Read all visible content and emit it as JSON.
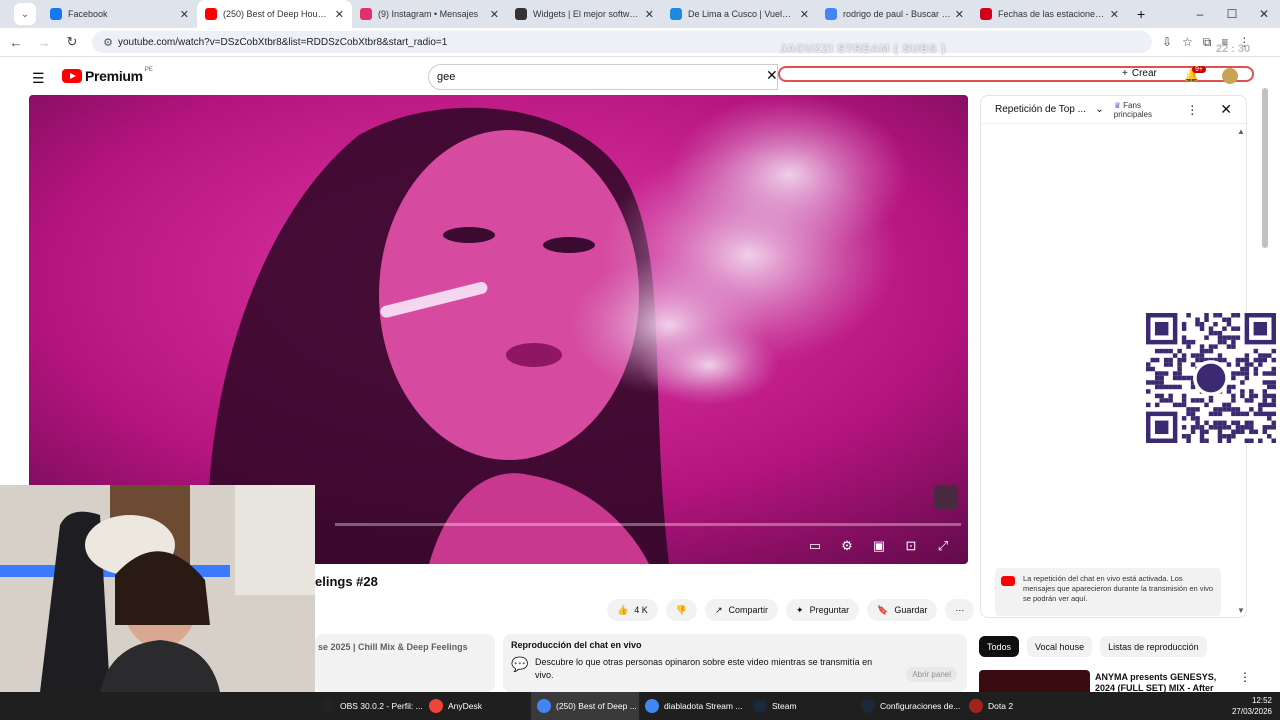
{
  "browser": {
    "tabs": [
      {
        "title": "Facebook",
        "color": "#1877f2",
        "active": false
      },
      {
        "title": "(250) Best of Deep House [20...",
        "color": "#ff0000",
        "active": true
      },
      {
        "title": "(9) Instagram • Mensajes",
        "color": "#e1306c",
        "active": false
      },
      {
        "title": "Widgets | El mejor software p...",
        "color": "#333333",
        "active": false
      },
      {
        "title": "De Lima a Cusco | Vuelos de ...",
        "color": "#1a8be0",
        "active": false
      },
      {
        "title": "rodrigo de paul - Buscar con ...",
        "color": "#4285f4",
        "active": false
      },
      {
        "title": "Fechas de las estaciones astro...",
        "color": "#d0021b",
        "active": false
      }
    ],
    "url": "youtube.com/watch?v=DSzCobXtbr8&list=RDDSzCobXtbr8&start_radio=1"
  },
  "overlay": {
    "stream_title": "JACUZZI STREAM ( SUBS )",
    "clock": "22 : 30"
  },
  "youtube": {
    "logo_text": "Premium",
    "country": "PE",
    "search_value": "gee",
    "create_label": "Crear",
    "notif_count": "9+"
  },
  "video": {
    "title_visible": "elings #28",
    "likes": "4 K",
    "share_label": "Compartir",
    "ask_label": "Preguntar",
    "save_label": "Guardar",
    "description_snippet": "se 2025 | Chill Mix & Deep Feelings"
  },
  "chat_replay_card": {
    "heading": "Reproducción del chat en vivo",
    "body": "Descubre lo que otras personas opinaron sobre este video mientras se transmitía en vivo.",
    "button": "Abrir panel"
  },
  "chat_panel": {
    "selector": "Repetición de Top ...",
    "fans_label": "Fans principales",
    "notice": "La repetición del chat en vivo está activada. Los mensajes que aparecieron durante la transmisión en vivo se podrán ver aquí."
  },
  "chips": [
    "Todos",
    "Vocal house",
    "Listas de reproducción"
  ],
  "recommendation": {
    "title": "ANYMA presents GENESYS, 2024 (FULL SET) MIX - After L..."
  },
  "taskbar": {
    "items": [
      {
        "label": "OBS 30.0.2 - Perfil: ...",
        "color": "#222222"
      },
      {
        "label": "AnyDesk",
        "color": "#ef443b"
      },
      {
        "label": "(250) Best of Deep ...",
        "color": "#4285f4"
      },
      {
        "label": "diabladota Stream ...",
        "color": "#4285f4"
      },
      {
        "label": "Steam",
        "color": "#1b2838"
      },
      {
        "label": "Configuraciones de...",
        "color": "#1b2838"
      },
      {
        "label": "Dota 2",
        "color": "#a0241b"
      }
    ],
    "time": "12:52",
    "date": "27/03/2026"
  }
}
